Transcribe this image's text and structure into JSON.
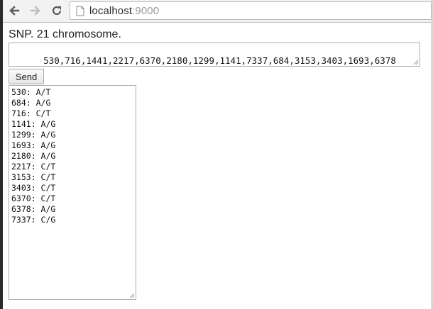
{
  "browser": {
    "url_host": "localhost",
    "url_port": ":9000"
  },
  "page": {
    "heading": "SNP. 21 chromosome.",
    "input_value": "530,716,1441,2217,6370,2180,1299,1141,7337,684,3153,3403,1693,6378",
    "send_label": "Send",
    "results": [
      "530: A/T",
      "684: A/G",
      "716: C/T",
      "1141: A/G",
      "1299: A/G",
      "1693: A/G",
      "2180: A/G",
      "2217: C/T",
      "3153: C/T",
      "3403: C/T",
      "6370: C/T",
      "6378: A/G",
      "7337: C/G"
    ]
  }
}
